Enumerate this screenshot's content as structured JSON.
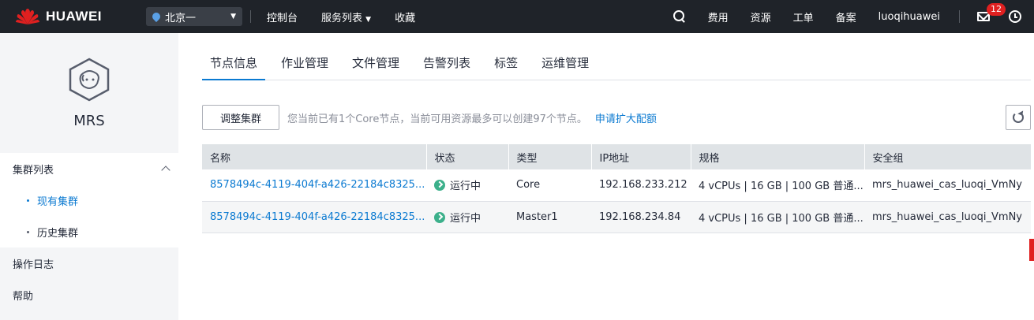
{
  "header": {
    "brand": "HUAWEI",
    "region": "北京一",
    "nav": [
      "控制台",
      "服务列表",
      "收藏"
    ],
    "right_links": [
      "费用",
      "资源",
      "工单",
      "备案"
    ],
    "username": "luoqihuawei",
    "message_count": "12",
    "brand_color": "#e02020"
  },
  "sidebar": {
    "product_name": "MRS",
    "cluster_group": "集群列表",
    "existing_clusters": "现有集群",
    "history_clusters": "历史集群",
    "operation_log": "操作日志",
    "help": "帮助"
  },
  "tabs": [
    "节点信息",
    "作业管理",
    "文件管理",
    "告警列表",
    "标签",
    "运维管理"
  ],
  "toolbar": {
    "adjust_button": "调整集群",
    "hint": "您当前已有1个Core节点，当前可用资源最多可以创建97个节点。",
    "apply_link": "申请扩大配额"
  },
  "table": {
    "headers": [
      "名称",
      "状态",
      "类型",
      "IP地址",
      "规格",
      "安全组"
    ],
    "rows": [
      {
        "name": "8578494c-4119-404f-a426-22184c8325...",
        "status": "运行中",
        "type": "Core",
        "ip": "192.168.233.212",
        "spec": "4 vCPUs | 16 GB | 100 GB 普通...",
        "security_group": "mrs_huawei_cas_luoqi_VmNy"
      },
      {
        "name": "8578494c-4119-404f-a426-22184c8325...",
        "status": "运行中",
        "type": "Master1",
        "ip": "192.168.234.84",
        "spec": "4 vCPUs | 16 GB | 100 GB 普通...",
        "security_group": "mrs_huawei_cas_luoqi_VmNy"
      }
    ]
  }
}
